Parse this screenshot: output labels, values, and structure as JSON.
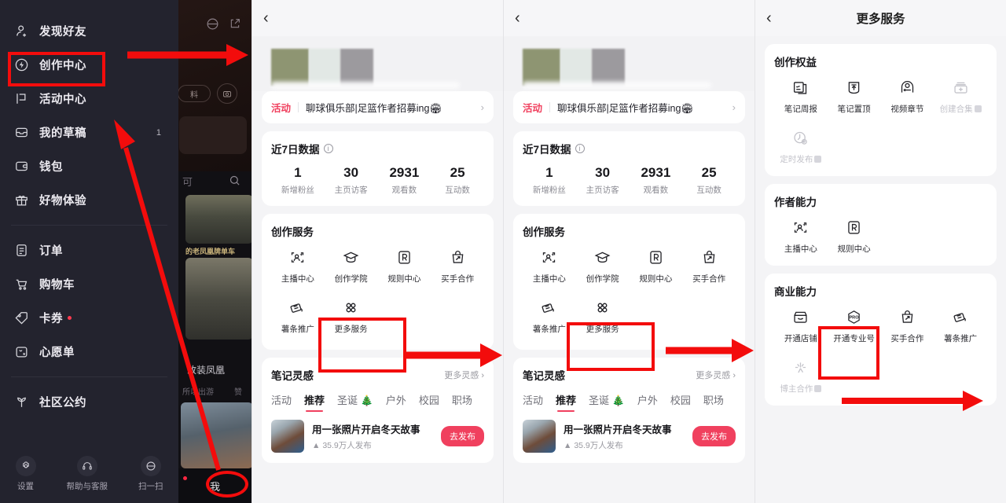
{
  "sidebar": {
    "items": [
      {
        "label": "发现好友",
        "icon": "person-add-icon",
        "badge": null,
        "dot": false
      },
      {
        "label": "创作中心",
        "icon": "creation-bolt-icon",
        "badge": null,
        "dot": false
      },
      {
        "label": "活动中心",
        "icon": "flag-icon",
        "badge": null,
        "dot": false
      },
      {
        "label": "我的草稿",
        "icon": "drafts-icon",
        "badge": "1",
        "dot": false
      },
      {
        "label": "钱包",
        "icon": "wallet-icon",
        "badge": null,
        "dot": false
      },
      {
        "label": "好物体验",
        "icon": "gift-icon",
        "badge": null,
        "dot": false
      }
    ],
    "items2": [
      {
        "label": "订单",
        "icon": "order-clipboard-icon",
        "badge": null,
        "dot": false
      },
      {
        "label": "购物车",
        "icon": "cart-icon",
        "badge": null,
        "dot": false
      },
      {
        "label": "卡券",
        "icon": "coupon-tag-icon",
        "badge": null,
        "dot": true
      },
      {
        "label": "心愿单",
        "icon": "wishlist-bag-icon",
        "badge": null,
        "dot": false
      }
    ],
    "items3": [
      {
        "label": "社区公约",
        "icon": "sprout-icon",
        "badge": null,
        "dot": false
      }
    ],
    "bottom": [
      {
        "label": "设置",
        "icon": "gear-icon"
      },
      {
        "label": "帮助与客服",
        "icon": "headset-icon"
      },
      {
        "label": "扫一扫",
        "icon": "scan-icon"
      }
    ],
    "tabbar_me": "我",
    "background": {
      "feed_tab": "可",
      "note1_caption": "的老凤凰牌单车",
      "note_title": "改装凤凰",
      "note_meta_author": "所以出游",
      "note_meta_like": "赞"
    }
  },
  "creation_center": {
    "back_icon": "back-chevron-icon",
    "activity": {
      "tag": "活动",
      "text": "聊球俱乐部|足篮作者招募ing🏟",
      "arrow_icon": "chevron-right-icon"
    },
    "seven_day": {
      "title": "近7日数据",
      "info_icon": "info-circle-icon",
      "stats": [
        {
          "value": "1",
          "label": "新增粉丝"
        },
        {
          "value": "30",
          "label": "主页访客"
        },
        {
          "value": "2931",
          "label": "观看数"
        },
        {
          "value": "25",
          "label": "互动数"
        }
      ]
    },
    "services": {
      "title": "创作服务",
      "items": [
        {
          "label": "主播中心",
          "icon": "anchor-center-icon",
          "locked": false
        },
        {
          "label": "创作学院",
          "icon": "graduation-cap-icon",
          "locked": false
        },
        {
          "label": "规则中心",
          "icon": "rule-r-icon",
          "locked": false
        },
        {
          "label": "买手合作",
          "icon": "buyer-bag-icon",
          "locked": false
        },
        {
          "label": "薯条推广",
          "icon": "promotion-card-icon",
          "locked": false
        },
        {
          "label": "更多服务",
          "icon": "more-dots-grid-icon",
          "locked": false
        }
      ]
    },
    "inspiration": {
      "title": "笔记灵感",
      "more": "更多灵感",
      "more_arrow_icon": "chevron-right-icon",
      "tabs": [
        {
          "label": "活动",
          "active": false
        },
        {
          "label": "推荐",
          "active": true
        },
        {
          "label": "圣诞 🎄",
          "active": false
        },
        {
          "label": "户外",
          "active": false
        },
        {
          "label": "校园",
          "active": false
        },
        {
          "label": "职场",
          "active": false
        }
      ],
      "item": {
        "title": "用一张照片开启冬天故事",
        "meta_icon": "fire-icon",
        "meta": "35.9万人发布",
        "button": "去发布"
      }
    }
  },
  "more_services": {
    "title": "更多服务",
    "back_icon": "back-chevron-icon",
    "sections": [
      {
        "title": "创作权益",
        "items": [
          {
            "label": "笔记周报",
            "icon": "weekly-report-icon",
            "locked": false
          },
          {
            "label": "笔记置顶",
            "icon": "pin-note-icon",
            "locked": false
          },
          {
            "label": "视频章节",
            "icon": "video-chapter-icon",
            "locked": false
          },
          {
            "label": "创建合集",
            "icon": "create-collection-icon",
            "locked": true
          },
          {
            "label": "定时发布",
            "icon": "schedule-clock-icon",
            "locked": true
          }
        ]
      },
      {
        "title": "作者能力",
        "items": [
          {
            "label": "主播中心",
            "icon": "anchor-center-icon",
            "locked": false
          },
          {
            "label": "规则中心",
            "icon": "rule-r-icon",
            "locked": false
          }
        ]
      },
      {
        "title": "商业能力",
        "items": [
          {
            "label": "开通店铺",
            "icon": "open-shop-icon",
            "locked": false
          },
          {
            "label": "开通专业号",
            "icon": "pro-badge-icon",
            "locked": false
          },
          {
            "label": "买手合作",
            "icon": "buyer-bag-icon",
            "locked": false
          },
          {
            "label": "薯条推广",
            "icon": "promotion-card-icon",
            "locked": false
          },
          {
            "label": "博主合作",
            "icon": "blogger-spark-icon",
            "locked": true
          }
        ]
      }
    ]
  },
  "annotations": {
    "accent": "#f30c0c",
    "highlight_creation_center": "创作中心",
    "highlight_more_services": "更多服务",
    "highlight_pro_account": "开通专业号",
    "highlight_me_tab": "我"
  }
}
